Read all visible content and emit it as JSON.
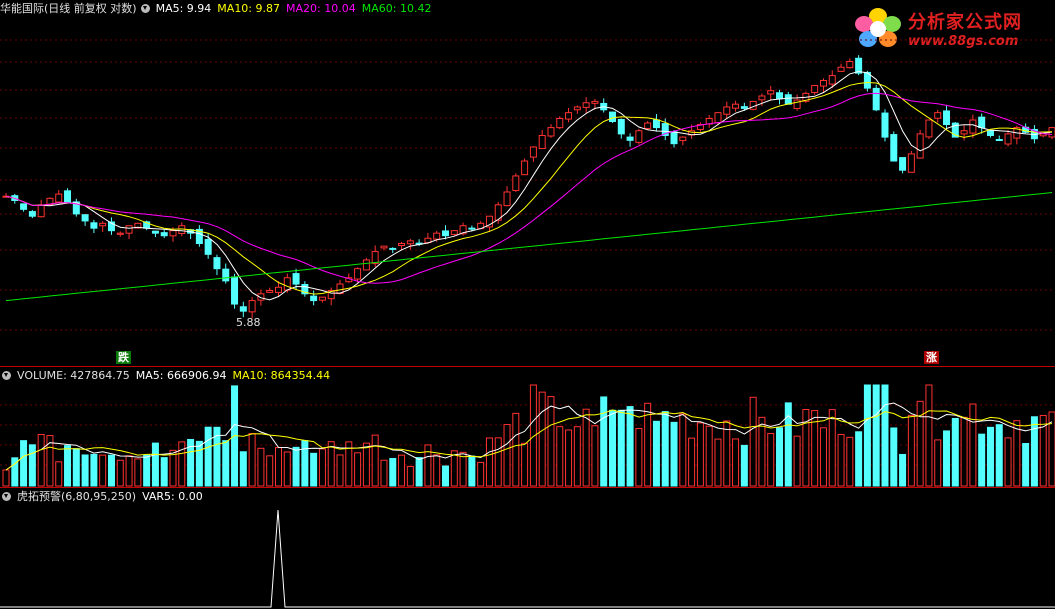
{
  "main_header": {
    "title": "华能国际(日线 前复权 对数)",
    "ma5": "MA5: 9.94",
    "ma10": "MA10: 9.87",
    "ma20": "MA20: 10.04",
    "ma60": "MA60: 10.42"
  },
  "volume_header": {
    "title": "VOLUME: 427864.75",
    "ma5": "MA5: 666906.94",
    "ma10": "MA10: 864354.44"
  },
  "indicator_header": {
    "title": "虎拓预警(6,80,95,250)",
    "var5": "VAR5: 0.00"
  },
  "low_price_label": "5.88",
  "signal_down": "跌",
  "signal_up": "涨",
  "logo": {
    "title": "分析家公式网",
    "url": "www.88gs.com",
    "icon": "flower-icon"
  },
  "colors": {
    "up": "#ff3232",
    "down": "#54ffff",
    "ma5": "#ffffff",
    "ma10": "#ffff00",
    "ma20": "#ff00ff",
    "ma60": "#00e600",
    "divider": "#c00000"
  },
  "chart_data": {
    "type": "candlestick",
    "close_series": [
      10.2,
      10.0,
      9.6,
      9.3,
      9.8,
      10.1,
      10.3,
      9.9,
      9.4,
      9.1,
      8.8,
      9.0,
      8.7,
      8.6,
      8.9,
      9.0,
      8.8,
      8.6,
      8.5,
      8.7,
      8.9,
      8.6,
      8.2,
      7.8,
      7.3,
      6.9,
      6.2,
      6.0,
      6.3,
      6.5,
      6.6,
      6.7,
      7.0,
      6.8,
      6.5,
      6.3,
      6.4,
      6.6,
      6.8,
      7.0,
      7.3,
      7.6,
      7.9,
      8.1,
      8.0,
      8.2,
      8.3,
      8.2,
      8.4,
      8.6,
      8.5,
      8.7,
      8.9,
      8.8,
      9.0,
      9.3,
      9.8,
      10.4,
      11.2,
      12.0,
      12.8,
      13.5,
      14.0,
      14.6,
      15.0,
      15.4,
      15.7,
      15.8,
      15.2,
      14.4,
      13.6,
      13.2,
      13.8,
      14.3,
      14.0,
      13.5,
      13.0,
      13.4,
      13.8,
      14.2,
      14.6,
      15.0,
      15.4,
      15.6,
      15.3,
      15.8,
      16.2,
      16.6,
      16.0,
      15.6,
      15.9,
      16.4,
      17.0,
      17.4,
      17.8,
      18.5,
      19.0,
      18.0,
      16.8,
      15.2,
      13.4,
      12.0,
      11.5,
      12.4,
      13.6,
      14.5,
      15.0,
      14.2,
      13.4,
      13.8,
      14.5,
      14.0,
      13.5,
      13.2,
      13.6,
      14.0,
      13.7,
      13.3,
      13.6,
      14.0
    ],
    "ma60_current": 10.42,
    "volume_last": 427864.75
  }
}
